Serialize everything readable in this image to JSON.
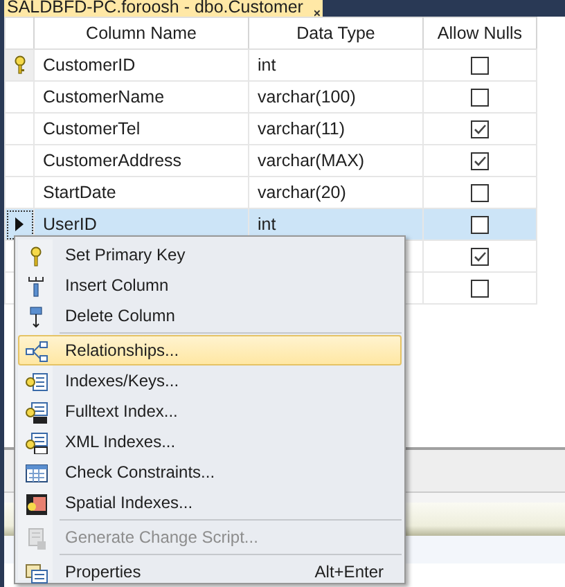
{
  "document_tab": {
    "title": "SALDBFD-PC.foroosh - dbo.Customer"
  },
  "table": {
    "columns": [
      "Column Name",
      "Data Type",
      "Allow Nulls"
    ],
    "rows": [
      {
        "name": "CustomerID",
        "data_type": "int",
        "allow_nulls": false,
        "primary_key": true,
        "selected": false
      },
      {
        "name": "CustomerName",
        "data_type": "varchar(100)",
        "allow_nulls": false,
        "primary_key": false,
        "selected": false
      },
      {
        "name": "CustomerTel",
        "data_type": "varchar(11)",
        "allow_nulls": true,
        "primary_key": false,
        "selected": false
      },
      {
        "name": "CustomerAddress",
        "data_type": "varchar(MAX)",
        "allow_nulls": true,
        "primary_key": false,
        "selected": false
      },
      {
        "name": "StartDate",
        "data_type": "varchar(20)",
        "allow_nulls": false,
        "primary_key": false,
        "selected": false
      },
      {
        "name": "UserID",
        "data_type": "int",
        "allow_nulls": false,
        "primary_key": false,
        "selected": true
      },
      {
        "allow_nulls": true,
        "primary_key": false,
        "selected": false
      },
      {
        "allow_nulls": false,
        "primary_key": false,
        "selected": false
      }
    ]
  },
  "context_menu": {
    "items": [
      {
        "kind": "item",
        "label": "Set Primary Key",
        "selected": false,
        "disabled": false
      },
      {
        "kind": "item",
        "label": "Insert Column",
        "selected": false,
        "disabled": false
      },
      {
        "kind": "item",
        "label": "Delete Column",
        "selected": false,
        "disabled": false
      },
      {
        "kind": "separator"
      },
      {
        "kind": "item",
        "label": "Relationships...",
        "selected": true,
        "disabled": false
      },
      {
        "kind": "item",
        "label": "Indexes/Keys...",
        "selected": false,
        "disabled": false
      },
      {
        "kind": "item",
        "label": "Fulltext Index...",
        "selected": false,
        "disabled": false
      },
      {
        "kind": "item",
        "label": "XML Indexes...",
        "selected": false,
        "disabled": false
      },
      {
        "kind": "item",
        "label": "Check Constraints...",
        "selected": false,
        "disabled": false
      },
      {
        "kind": "item",
        "label": "Spatial Indexes...",
        "selected": false,
        "disabled": false
      },
      {
        "kind": "separator"
      },
      {
        "kind": "item",
        "label": "Generate Change Script...",
        "selected": false,
        "disabled": true
      },
      {
        "kind": "separator"
      },
      {
        "kind": "item",
        "label": "Properties",
        "shortcut": "Alt+Enter",
        "selected": false,
        "disabled": false
      }
    ]
  }
}
